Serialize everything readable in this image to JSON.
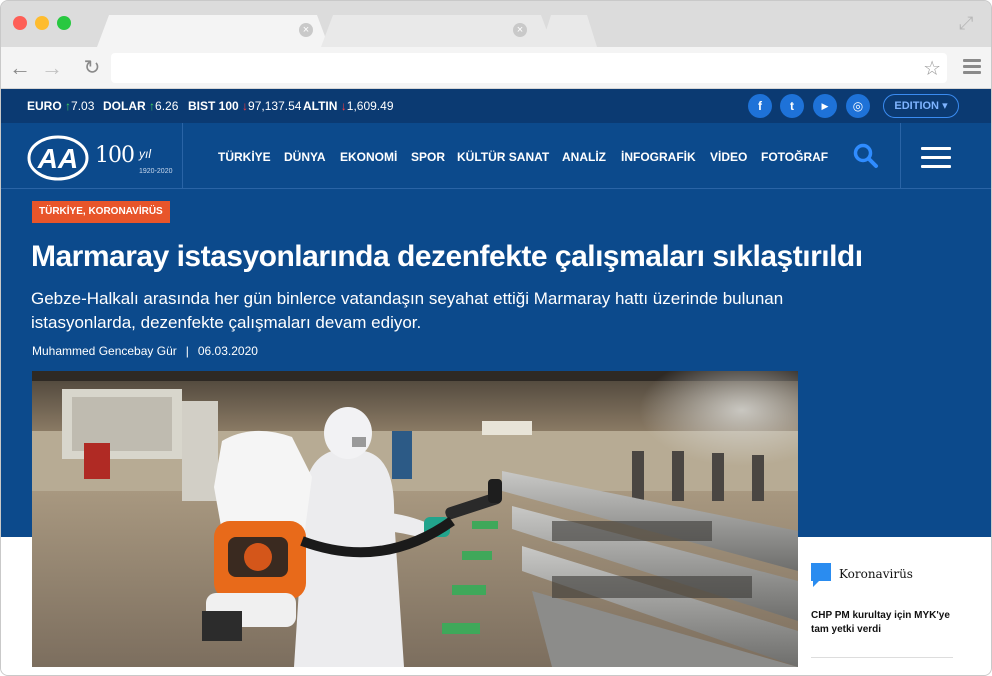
{
  "ticker": [
    {
      "label": "EURO",
      "dir": "up",
      "value": "7.03"
    },
    {
      "label": "DOLAR",
      "dir": "up",
      "value": "6.26"
    },
    {
      "label": "BIST 100",
      "dir": "down",
      "value": "97,137.54"
    },
    {
      "label": "ALTIN",
      "dir": "down",
      "value": "1,609.49"
    }
  ],
  "social": {
    "facebook": "f",
    "twitter": "t",
    "youtube": "▶",
    "instagram": "◎"
  },
  "edition_label": "EDITION",
  "logo": {
    "text": "AA",
    "anniv_number": "100",
    "anniv_word": "yıl",
    "anniv_years": "1920-2020"
  },
  "nav": [
    "TÜRKİYE",
    "DÜNYA",
    "EKONOMİ",
    "SPOR",
    "KÜLTÜR SANAT",
    "ANALİZ",
    "İNFOGRAFİK",
    "VİDEO",
    "FOTOĞRAF"
  ],
  "article": {
    "category": "TÜRKİYE, KORONAVİRÜS",
    "headline": "Marmaray istasyonlarında dezenfekte çalışmaları sıklaştırıldı",
    "summary": "Gebze-Halkalı arasında her gün binlerce vatandaşın seyahat ettiği Marmaray hattı üzerinde bulunan istasyonlarda, dezenfekte çalışmaları devam ediyor.",
    "author": "Muhammed Gencebay Gür",
    "separator": "|",
    "date": "06.03.2020"
  },
  "sidebar": {
    "title": "Koronavirüs",
    "item": "CHP PM kurultay için MYK'ye tam yetki verdi"
  },
  "colors": {
    "brand_blue": "#0c4a8c",
    "ticker_bar": "#0b3a72",
    "category": "#e8552a",
    "social": "#1e72d8"
  }
}
